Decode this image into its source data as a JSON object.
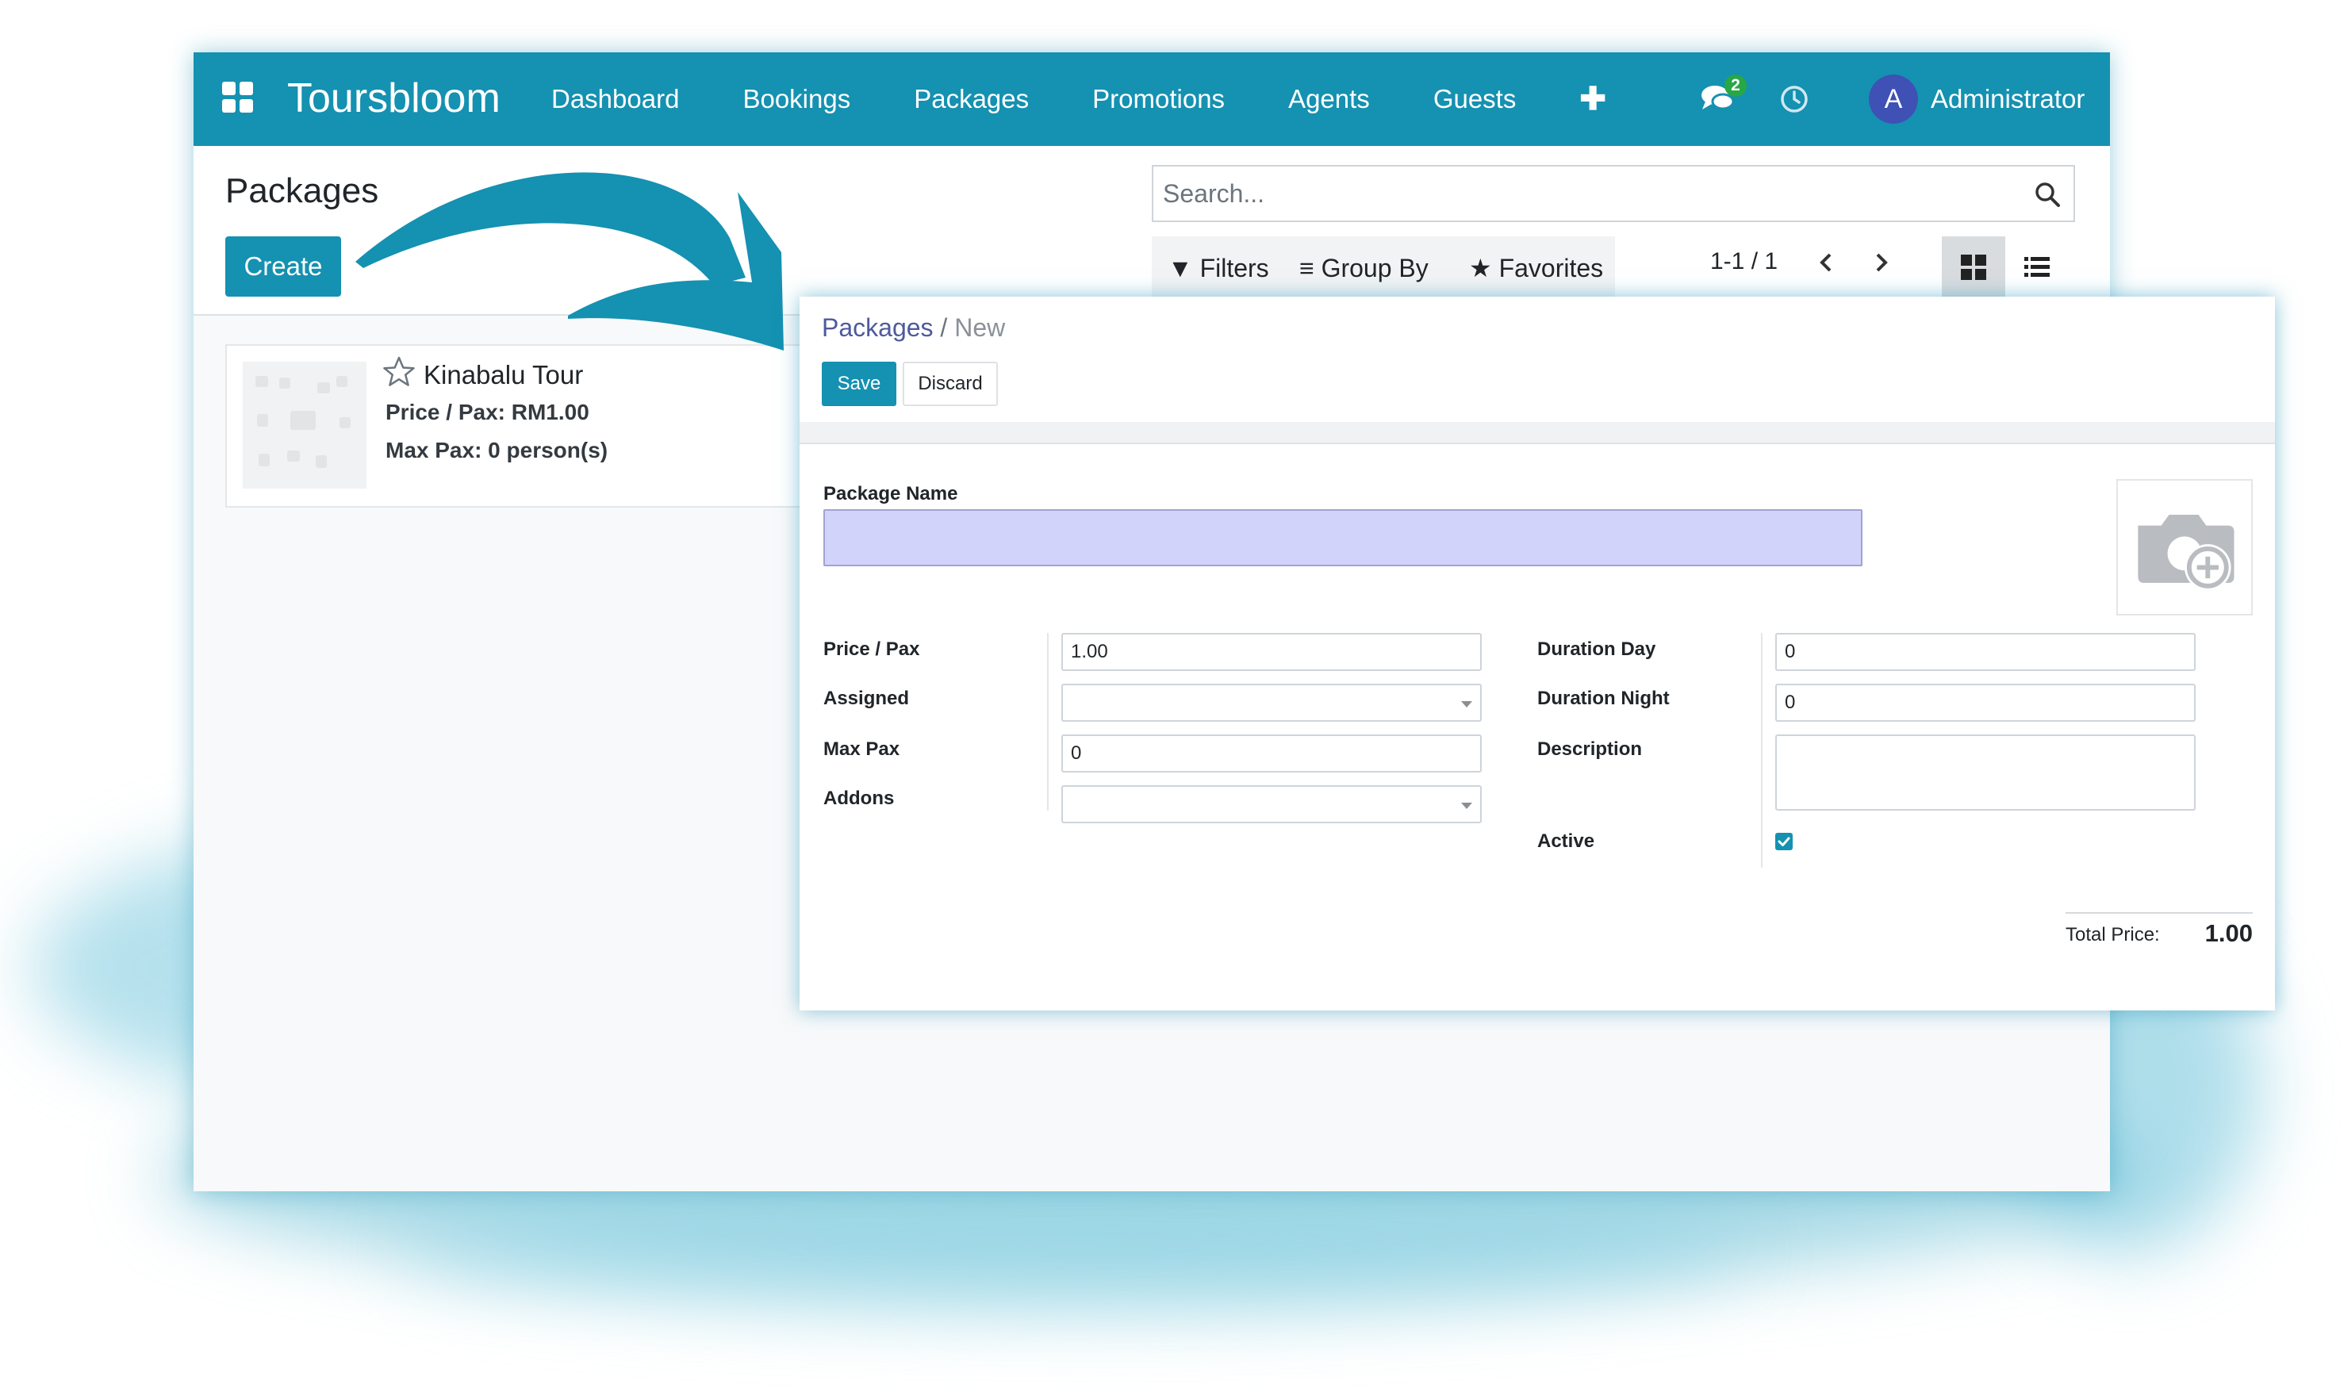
{
  "app": {
    "brand": "Toursbloom",
    "accent_color": "#1591b1",
    "nav": [
      "Dashboard",
      "Bookings",
      "Packages",
      "Promotions",
      "Agents",
      "Guests"
    ],
    "add_icon": "plus-icon",
    "chat_badge": "2",
    "user_initial": "A",
    "user_name": "Administrator"
  },
  "list_view": {
    "title": "Packages",
    "create_label": "Create",
    "search_placeholder": "Search...",
    "filters_label": "Filters",
    "group_by_label": "Group By",
    "favorites_label": "Favorites",
    "pager": "1-1 / 1",
    "cards": [
      {
        "title": "Kinabalu Tour",
        "price_line": "Price / Pax: RM1.00",
        "max_pax_line": "Max Pax: 0 person(s)"
      }
    ]
  },
  "form": {
    "breadcrumb_parent": "Packages",
    "breadcrumb_separator": "/",
    "breadcrumb_current": "New",
    "save_label": "Save",
    "discard_label": "Discard",
    "package_name_label": "Package Name",
    "package_name_value": "",
    "left_fields": [
      {
        "label": "Price / Pax",
        "value": "1.00"
      },
      {
        "label": "Assigned",
        "value": ""
      },
      {
        "label": "Max Pax",
        "value": "0"
      },
      {
        "label": "Addons",
        "value": ""
      }
    ],
    "right_fields": [
      {
        "label": "Duration Day",
        "value": "0"
      },
      {
        "label": "Duration Night",
        "value": "0"
      },
      {
        "label": "Description",
        "value": ""
      },
      {
        "label": "Active",
        "checked": true
      }
    ],
    "total_label": "Total Price:",
    "total_value": "1.00"
  }
}
